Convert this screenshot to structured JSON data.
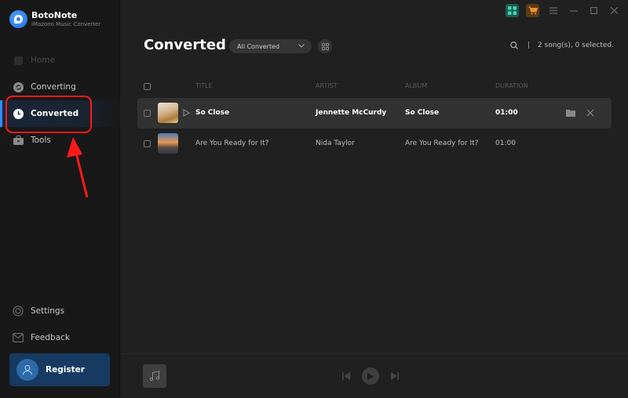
{
  "app": {
    "name": "BotoNote",
    "subtitle": "iMazono Music Converter"
  },
  "sidebar": {
    "items": [
      {
        "label": "Home",
        "icon": "home-icon",
        "state": "disabled"
      },
      {
        "label": "Converting",
        "icon": "refresh-icon",
        "state": "normal"
      },
      {
        "label": "Converted",
        "icon": "clock-icon",
        "state": "active"
      },
      {
        "label": "Tools",
        "icon": "toolbox-icon",
        "state": "normal"
      }
    ],
    "bottom_items": [
      {
        "label": "Settings",
        "icon": "gear-icon"
      },
      {
        "label": "Feedback",
        "icon": "mail-icon"
      }
    ],
    "register_label": "Register"
  },
  "topbar": {
    "icons": [
      "apps-icon",
      "cart-icon",
      "menu-icon",
      "minimize-icon",
      "maximize-icon",
      "close-icon"
    ],
    "accent_apps": "#1e5a4e",
    "accent_cart": "#5a3a18"
  },
  "main": {
    "title": "Converted",
    "filter": {
      "selected": "All Converted"
    },
    "status": "2 song(s), 0 selected.",
    "columns": [
      "TITLE",
      "ARTIST",
      "ALBUM",
      "DURATION"
    ],
    "rows": [
      {
        "title": "So Close",
        "artist": "Jennette McCurdy",
        "album": "So Close",
        "duration": "01:00",
        "active": true
      },
      {
        "title": "Are You Ready for It?",
        "artist": "Nida Taylor",
        "album": "Are You Ready for It?",
        "duration": "01:00",
        "active": false
      }
    ]
  },
  "annotation": {
    "highlight_color": "#ff1a1a"
  },
  "colors": {
    "active_accent": "#2f8cff",
    "register_bg": "#163a61"
  }
}
